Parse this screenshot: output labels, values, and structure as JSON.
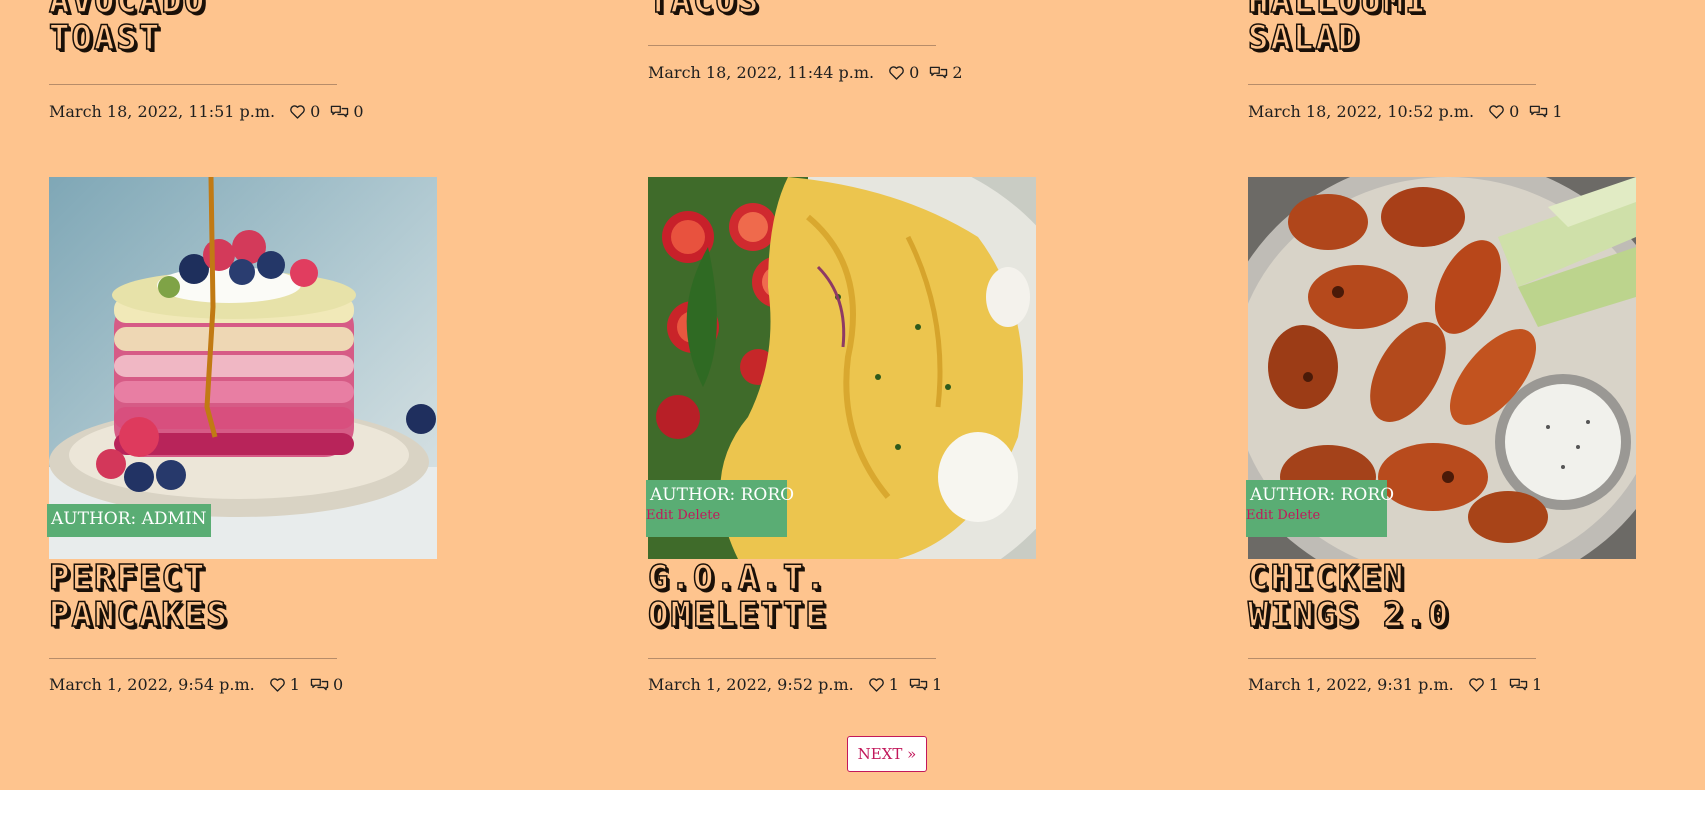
{
  "posts_top": [
    {
      "title_line1": "AVOCADO",
      "title_line2": "TOAST",
      "date": "March 18, 2022, 11:51 p.m.",
      "likes": "0",
      "comments": "0"
    },
    {
      "title_line1": "TACOS",
      "title_line2": "",
      "date": "March 18, 2022, 11:44 p.m.",
      "likes": "0",
      "comments": "2"
    },
    {
      "title_line1": "HALLOUMI",
      "title_line2": "SALAD",
      "date": "March 18, 2022, 10:52 p.m.",
      "likes": "0",
      "comments": "1"
    }
  ],
  "posts_bottom": [
    {
      "author": "AUTHOR: ADMIN",
      "edit_label": "",
      "delete_label": "",
      "title_line1": "PERFECT",
      "title_line2": "PANCAKES",
      "date": "March 1, 2022, 9:54 p.m.",
      "likes": "1",
      "comments": "0"
    },
    {
      "author": "AUTHOR: RORO",
      "edit_label": "Edit",
      "delete_label": "Delete",
      "title_line1": "G.O.A.T.",
      "title_line2": "OMELETTE",
      "date": "March 1, 2022, 9:52 p.m.",
      "likes": "1",
      "comments": "1"
    },
    {
      "author": "AUTHOR: RORO",
      "edit_label": "Edit",
      "delete_label": "Delete",
      "title_line1": "CHICKEN",
      "title_line2": "WINGS 2.0",
      "date": "March 1, 2022, 9:31 p.m.",
      "likes": "1",
      "comments": "1"
    }
  ],
  "pagination": {
    "next_label": "NEXT »"
  },
  "icons": {
    "likes": "heart-outline-icon",
    "comments": "speech-bubbles-icon"
  },
  "colors": {
    "page_background": "#fec48e",
    "author_badge": "#5aad74",
    "link_accent": "#c2185b",
    "title_outline": "#1a1008"
  }
}
